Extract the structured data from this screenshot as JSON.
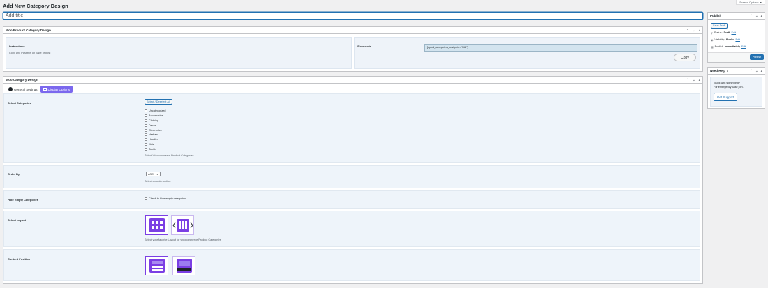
{
  "page": {
    "title": "Add New Category Design",
    "screen_options": "Screen Options"
  },
  "title_field": {
    "placeholder": "Add title"
  },
  "woo_box": {
    "title": "Woo Product Category Design",
    "instructions_label": "Instructions",
    "instructions_text": "Copy and Past this on page or post",
    "shortcode_label": "Shortcode",
    "shortcode_value": "[dpcd_categories_design id=\"952\"]",
    "copy_label": "Copy"
  },
  "design_box": {
    "title": "Woo Category Design",
    "tabs": [
      {
        "label": "General Settings",
        "active": false
      },
      {
        "label": "Display Options",
        "active": true
      }
    ],
    "select_categories": {
      "label": "Select Categories",
      "button": "Select / Deselect All",
      "items": [
        "Uncategorized",
        "Accessories",
        "Clothing",
        "Decor",
        "Electronics",
        "Herbals",
        "Hoodies",
        "Kids",
        "Tshirts"
      ],
      "help": "Select Woocommerce Product Categories"
    },
    "order_by": {
      "label": "Order By",
      "value": "ASC",
      "help": "Select an order option."
    },
    "hide_empty": {
      "label": "Hide Empty Categories",
      "checkbox": "Check to hide empty categories"
    },
    "select_layout": {
      "label": "Select Layout",
      "help": "Select your favorite Layout for woocommerce Product Categories"
    },
    "content_position": {
      "label": "Content Position"
    }
  },
  "publish_box": {
    "title": "Publish",
    "save_draft": "Save Draft",
    "status_label": "Status:",
    "status_value": "Draft",
    "visibility_label": "Visibility:",
    "visibility_value": "Public",
    "publish_label": "Publish",
    "publish_when": "immediately",
    "edit": "Edit",
    "publish_button": "Publish"
  },
  "help_box": {
    "title": "Need Help ?",
    "line1": "Stuck with something?",
    "line2": "For emergency case join.",
    "button": "Get Support"
  },
  "colors": {
    "accent": "#2271b1",
    "tab_active": "#7b68ee",
    "layout_purple": "#7b3fe4"
  }
}
